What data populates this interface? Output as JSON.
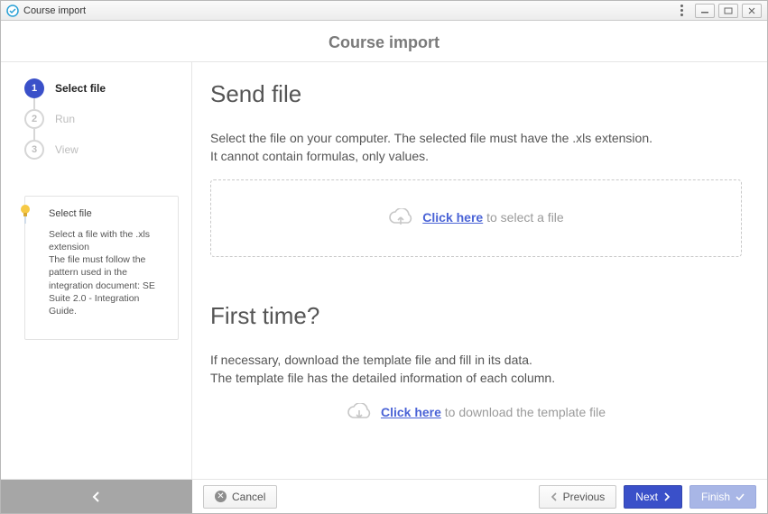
{
  "window": {
    "title": "Course import"
  },
  "page": {
    "title": "Course import"
  },
  "steps": [
    {
      "num": "1",
      "label": "Select file",
      "state": "active"
    },
    {
      "num": "2",
      "label": "Run",
      "state": "inactive"
    },
    {
      "num": "3",
      "label": "View",
      "state": "inactive"
    }
  ],
  "hint": {
    "title": "Select file",
    "body": "Select a file with the .xls extension\nThe file must follow the pattern used in the integration document: SE Suite 2.0 - Integration Guide."
  },
  "send": {
    "heading": "Send file",
    "desc1": "Select the file on your computer. The selected file must have the .xls extension.",
    "desc2": "It cannot contain formulas, only values.",
    "link": "Click here",
    "rest": " to select a file"
  },
  "first": {
    "heading": "First time?",
    "desc1": "If necessary, download the template file and fill in its data.",
    "desc2": "The template file has the detailed information of each column.",
    "link": "Click here",
    "rest": " to download the template file"
  },
  "footer": {
    "cancel": "Cancel",
    "previous": "Previous",
    "next": "Next",
    "finish": "Finish"
  }
}
